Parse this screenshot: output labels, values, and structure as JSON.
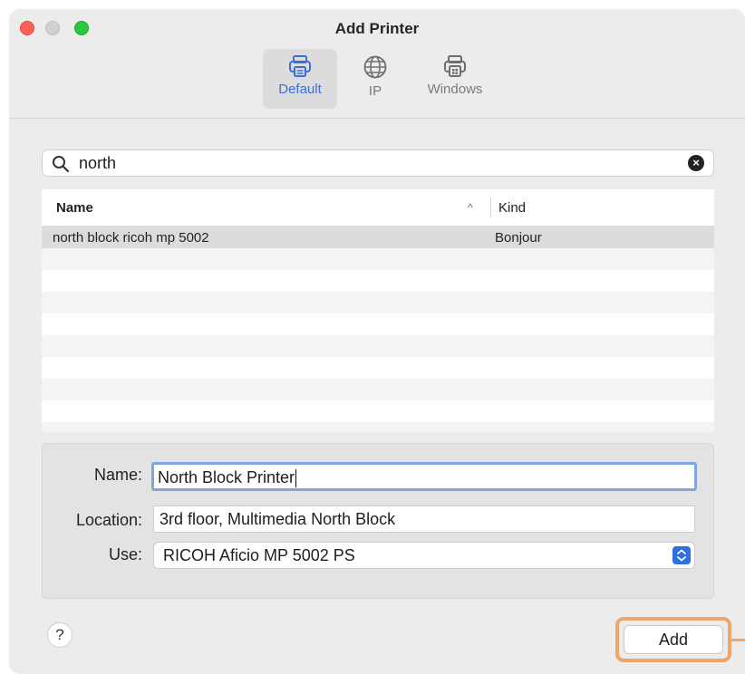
{
  "window": {
    "title": "Add Printer"
  },
  "toolbar": {
    "tabs": [
      {
        "label": "Default",
        "icon": "printer-icon",
        "active": true
      },
      {
        "label": "IP",
        "icon": "globe-icon",
        "active": false
      },
      {
        "label": "Windows",
        "icon": "windows-printer-icon",
        "active": false
      }
    ]
  },
  "search": {
    "value": "north"
  },
  "table": {
    "columns": [
      "Name",
      "Kind"
    ],
    "rows": [
      {
        "name": "north block ricoh mp 5002",
        "kind": "Bonjour",
        "selected": true
      }
    ]
  },
  "form": {
    "name_label": "Name:",
    "name_value": "North Block Printer",
    "location_label": "Location:",
    "location_value": "3rd floor, Multimedia North Block",
    "use_label": "Use:",
    "use_value": "RICOH Aficio MP 5002 PS"
  },
  "buttons": {
    "help": "?",
    "add": "Add"
  },
  "colors": {
    "accent": "#3b6fd6",
    "highlight_ring": "#f0a56b",
    "stepper": "#2f6ee3"
  }
}
